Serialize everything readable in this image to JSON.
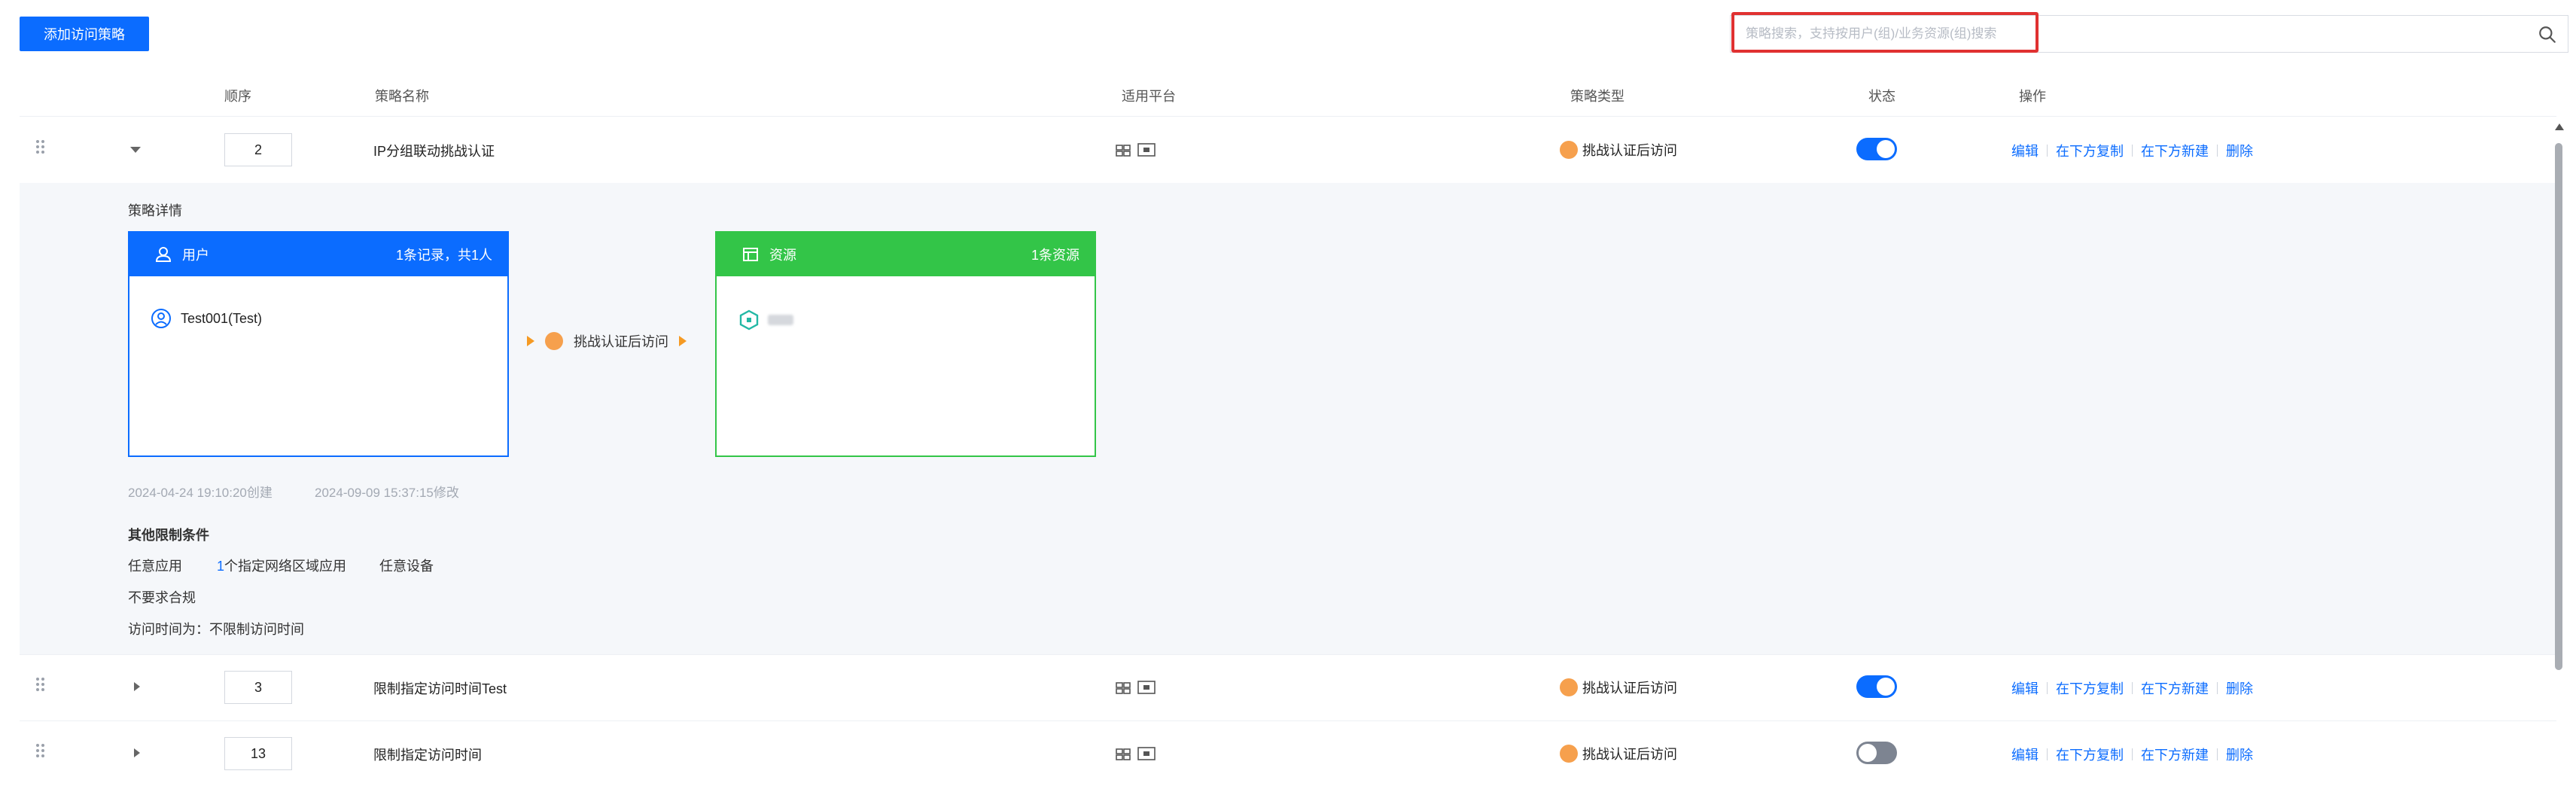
{
  "toolbar": {
    "add_button": "添加访问策略"
  },
  "search": {
    "placeholder": "策略搜索，支持按用户(组)/业务资源(组)搜索",
    "value": ""
  },
  "columns": {
    "order": "顺序",
    "name": "策略名称",
    "platform": "适用平台",
    "type": "策略类型",
    "status": "状态",
    "ops": "操作"
  },
  "ops_labels": {
    "edit": "编辑",
    "copy_below": "在下方复制",
    "new_below": "在下方新建",
    "delete": "删除"
  },
  "rows": [
    {
      "order": "2",
      "name": "IP分组联动挑战认证",
      "type": "挑战认证后访问",
      "enabled": true,
      "expanded": true
    },
    {
      "order": "3",
      "name": "限制指定访问时间Test",
      "type": "挑战认证后访问",
      "enabled": true,
      "expanded": false
    },
    {
      "order": "13",
      "name": "限制指定访问时间",
      "type": "挑战认证后访问",
      "enabled": false,
      "expanded": false
    }
  ],
  "detail": {
    "title": "策略详情",
    "user_card": {
      "title": "用户",
      "summary": "1条记录，共1人",
      "item": "Test001(Test)"
    },
    "flow_label": "挑战认证后访问",
    "resource_card": {
      "title": "资源",
      "summary": "1条资源"
    },
    "created": "2024-04-24 19:10:20创建",
    "modified": "2024-09-09 15:37:15修改",
    "conditions_title": "其他限制条件",
    "cond_app": "任意应用",
    "cond_region_count": "1",
    "cond_region": "个指定网络区域应用",
    "cond_device": "任意设备",
    "cond_compliance": "不要求合规",
    "cond_time": "访问时间为：不限制访问时间"
  },
  "colors": {
    "accent": "#0b6cff",
    "resource": "#33c548",
    "policy_icon": "#f6a04d",
    "highlight": "#e03131"
  }
}
